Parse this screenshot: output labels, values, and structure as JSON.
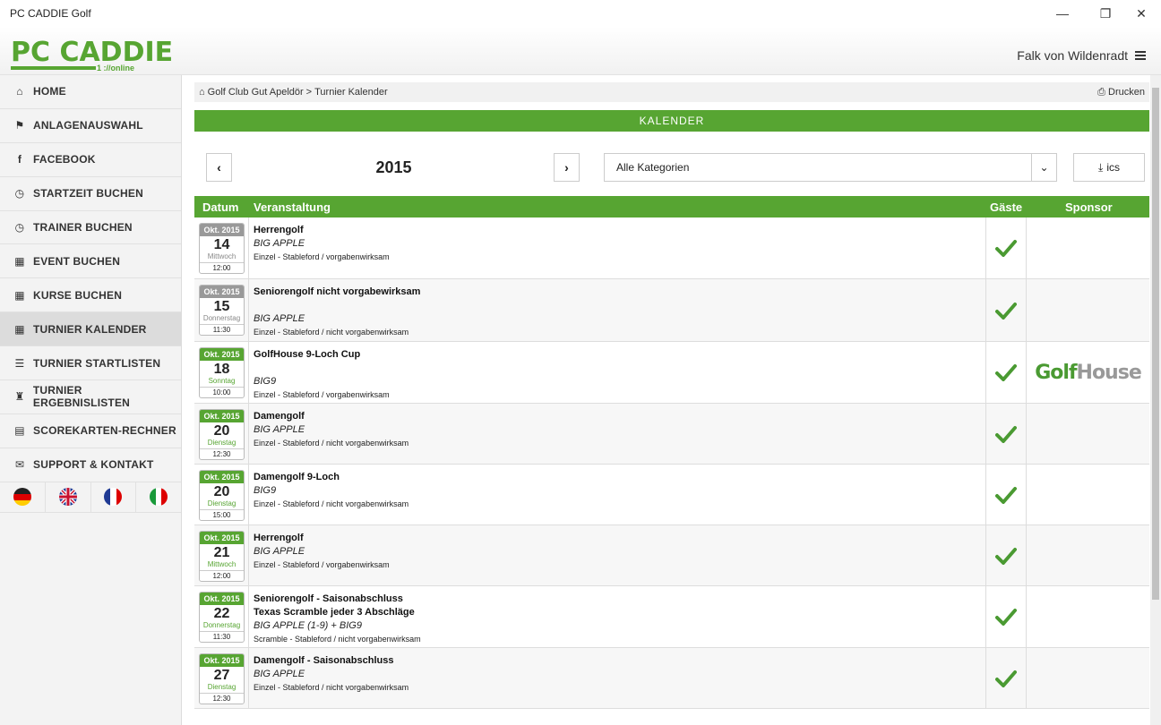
{
  "window": {
    "title": "PC CADDIE Golf",
    "minimize": "—",
    "maximize": "❐",
    "close": "✕"
  },
  "header": {
    "logo_main": "PC CADDIE",
    "logo_sub": "1 ://online",
    "user_name": "Falk von Wildenradt"
  },
  "sidebar": {
    "items": [
      {
        "label": "HOME",
        "icon": "⌂"
      },
      {
        "label": "ANLAGENAUSWAHL",
        "icon": "⚑"
      },
      {
        "label": "FACEBOOK",
        "icon": "f"
      },
      {
        "label": "STARTZEIT BUCHEN",
        "icon": "◷"
      },
      {
        "label": "TRAINER BUCHEN",
        "icon": "◷"
      },
      {
        "label": "EVENT BUCHEN",
        "icon": "▦"
      },
      {
        "label": "KURSE BUCHEN",
        "icon": "▦"
      },
      {
        "label": "TURNIER KALENDER",
        "icon": "▦"
      },
      {
        "label": "TURNIER STARTLISTEN",
        "icon": "☰"
      },
      {
        "label": "TURNIER ERGEBNISLISTEN",
        "icon": "♜"
      },
      {
        "label": "SCOREKARTEN-RECHNER",
        "icon": "▤"
      },
      {
        "label": "SUPPORT & KONTAKT",
        "icon": "✉"
      }
    ]
  },
  "breadcrumb": {
    "home_icon": "⌂",
    "club": "Golf Club Gut Apeldör",
    "separator": ">",
    "page": "Turnier Kalender",
    "print_icon": "⎙",
    "print_label": "Drucken"
  },
  "calendar": {
    "title": "KALENDER",
    "prev": "‹",
    "next": "›",
    "year": "2015",
    "category_selected": "Alle Kategorien",
    "dropdown_icon": "⌄",
    "ics_icon": "⤓",
    "ics_label": "ics"
  },
  "table": {
    "headers": {
      "date": "Datum",
      "event": "Veranstaltung",
      "guests": "Gäste",
      "sponsor": "Sponsor"
    },
    "rows": [
      {
        "month": "Okt. 2015",
        "day": "14",
        "weekday": "Mittwoch",
        "time": "12:00",
        "title": "Herrengolf",
        "title2": "",
        "course": "BIG APPLE",
        "mode": "Einzel - Stableford / vorgabenwirksam",
        "sponsor_a": "",
        "sponsor_b": ""
      },
      {
        "month": "Okt. 2015",
        "day": "15",
        "weekday": "Donnerstag",
        "time": "11:30",
        "title": "Seniorengolf nicht vorgabewirksam",
        "title2": "",
        "course": "BIG APPLE",
        "mode": "Einzel - Stableford / nicht vorgabenwirksam",
        "sponsor_a": "",
        "sponsor_b": ""
      },
      {
        "month": "Okt. 2015",
        "day": "18",
        "weekday": "Sonntag",
        "time": "10:00",
        "title": "GolfHouse 9-Loch Cup",
        "title2": "",
        "course": "BIG9",
        "mode": "Einzel - Stableford / vorgabenwirksam",
        "sponsor_a": "Golf",
        "sponsor_b": "House"
      },
      {
        "month": "Okt. 2015",
        "day": "20",
        "weekday": "Dienstag",
        "time": "12:30",
        "title": "Damengolf",
        "title2": "",
        "course": "BIG APPLE",
        "mode": "Einzel - Stableford / nicht vorgabenwirksam",
        "sponsor_a": "",
        "sponsor_b": ""
      },
      {
        "month": "Okt. 2015",
        "day": "20",
        "weekday": "Dienstag",
        "time": "15:00",
        "title": "Damengolf 9-Loch",
        "title2": "",
        "course": "BIG9",
        "mode": "Einzel - Stableford / nicht vorgabenwirksam",
        "sponsor_a": "",
        "sponsor_b": ""
      },
      {
        "month": "Okt. 2015",
        "day": "21",
        "weekday": "Mittwoch",
        "time": "12:00",
        "title": "Herrengolf",
        "title2": "",
        "course": "BIG APPLE",
        "mode": "Einzel - Stableford / vorgabenwirksam",
        "sponsor_a": "",
        "sponsor_b": ""
      },
      {
        "month": "Okt. 2015",
        "day": "22",
        "weekday": "Donnerstag",
        "time": "11:30",
        "title": "Seniorengolf - Saisonabschluss",
        "title2": "Texas Scramble jeder 3 Abschläge",
        "course": "BIG APPLE (1-9) + BIG9",
        "mode": "Scramble - Stableford / nicht vorgabenwirksam",
        "sponsor_a": "",
        "sponsor_b": ""
      },
      {
        "month": "Okt. 2015",
        "day": "27",
        "weekday": "Dienstag",
        "time": "12:30",
        "title": "Damengolf - Saisonabschluss",
        "title2": "",
        "course": "BIG APPLE",
        "mode": "Einzel - Stableford / nicht vorgabenwirksam",
        "sponsor_a": "",
        "sponsor_b": ""
      }
    ]
  },
  "colors": {
    "accent": "#57a532",
    "check": "#4a9a32"
  }
}
